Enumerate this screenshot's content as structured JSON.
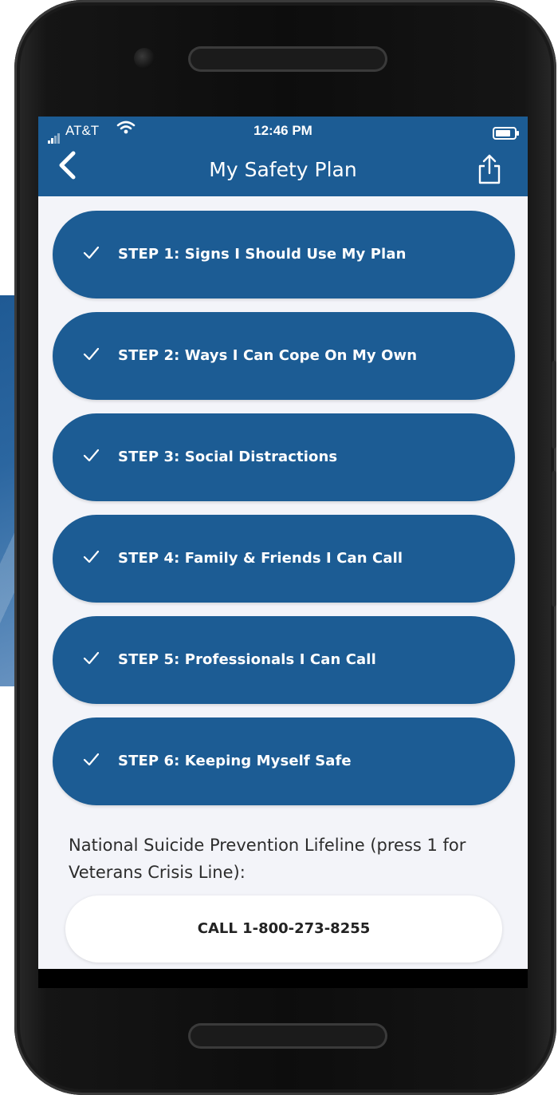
{
  "status_bar": {
    "carrier": "AT&T",
    "time": "12:46 PM"
  },
  "header": {
    "title": "My Safety Plan"
  },
  "steps": [
    {
      "label": "STEP 1: Signs I Should Use My Plan"
    },
    {
      "label": "STEP 2: Ways I Can Cope On My Own"
    },
    {
      "label": "STEP 3: Social Distractions"
    },
    {
      "label": "STEP 4: Family & Friends I Can Call"
    },
    {
      "label": "STEP 5: Professionals I Can Call"
    },
    {
      "label": "STEP 6: Keeping Myself Safe"
    }
  ],
  "lifeline": {
    "text": "National Suicide Prevention Lifeline (press 1 for Veterans Crisis Line):",
    "call_label": "CALL 1-800-273-8255"
  },
  "icons": {
    "back": "chevron-left-icon",
    "share": "share-icon",
    "check": "checkmark-icon",
    "wifi": "wifi-icon",
    "signal": "signal-icon",
    "battery": "battery-icon"
  },
  "colors": {
    "primary": "#1c5c94",
    "screen_bg": "#f3f4f9",
    "button_white": "#ffffff"
  }
}
